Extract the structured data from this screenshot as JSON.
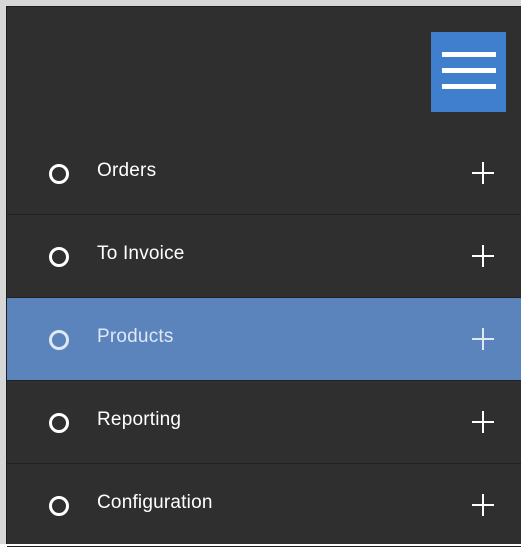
{
  "menu_toggle": {
    "icon": "hamburger-menu-icon",
    "color": "#3f7fce"
  },
  "colors": {
    "panel_background": "#2f2f2f",
    "active_item_background": "#5b84bd",
    "text": "#ffffff"
  },
  "menu": {
    "items": [
      {
        "label": "Orders",
        "icon": "circle-icon",
        "expand_icon": "plus-icon",
        "active": false
      },
      {
        "label": "To Invoice",
        "icon": "circle-icon",
        "expand_icon": "plus-icon",
        "active": false
      },
      {
        "label": "Products",
        "icon": "circle-icon",
        "expand_icon": "plus-icon",
        "active": true
      },
      {
        "label": "Reporting",
        "icon": "circle-icon",
        "expand_icon": "plus-icon",
        "active": false
      },
      {
        "label": "Configuration",
        "icon": "circle-icon",
        "expand_icon": "plus-icon",
        "active": false
      }
    ]
  }
}
